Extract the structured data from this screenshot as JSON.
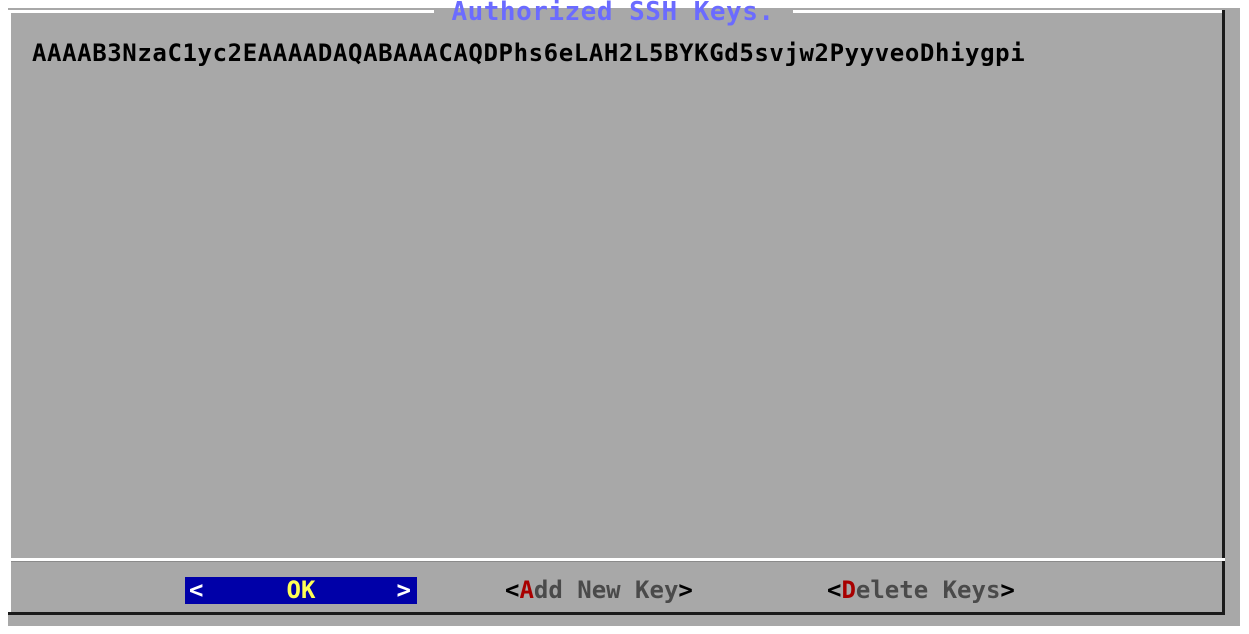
{
  "dialog": {
    "title": "Authorized SSH Keys."
  },
  "keys": [
    "AAAAB3NzaC1yc2EAAAADAQABAAACAQDPhs6eLAH2L5BYKGd5svjw2PyyveoDhiygpi"
  ],
  "buttons": {
    "ok": {
      "left_bracket": "<",
      "label": "OK",
      "right_bracket": ">"
    },
    "add": {
      "left_bracket": "<",
      "hotkey": "A",
      "rest": "dd New Key",
      "right_bracket": ">"
    },
    "delete": {
      "left_bracket": "<",
      "hotkey": "D",
      "rest": "elete Keys",
      "right_bracket": ">"
    }
  },
  "colors": {
    "dialog_bg": "#a8a8a8",
    "title": "#6b6bff",
    "button_focus_bg": "#0000a8",
    "button_focus_text": "#ffff55",
    "hotkey": "#a80000"
  }
}
